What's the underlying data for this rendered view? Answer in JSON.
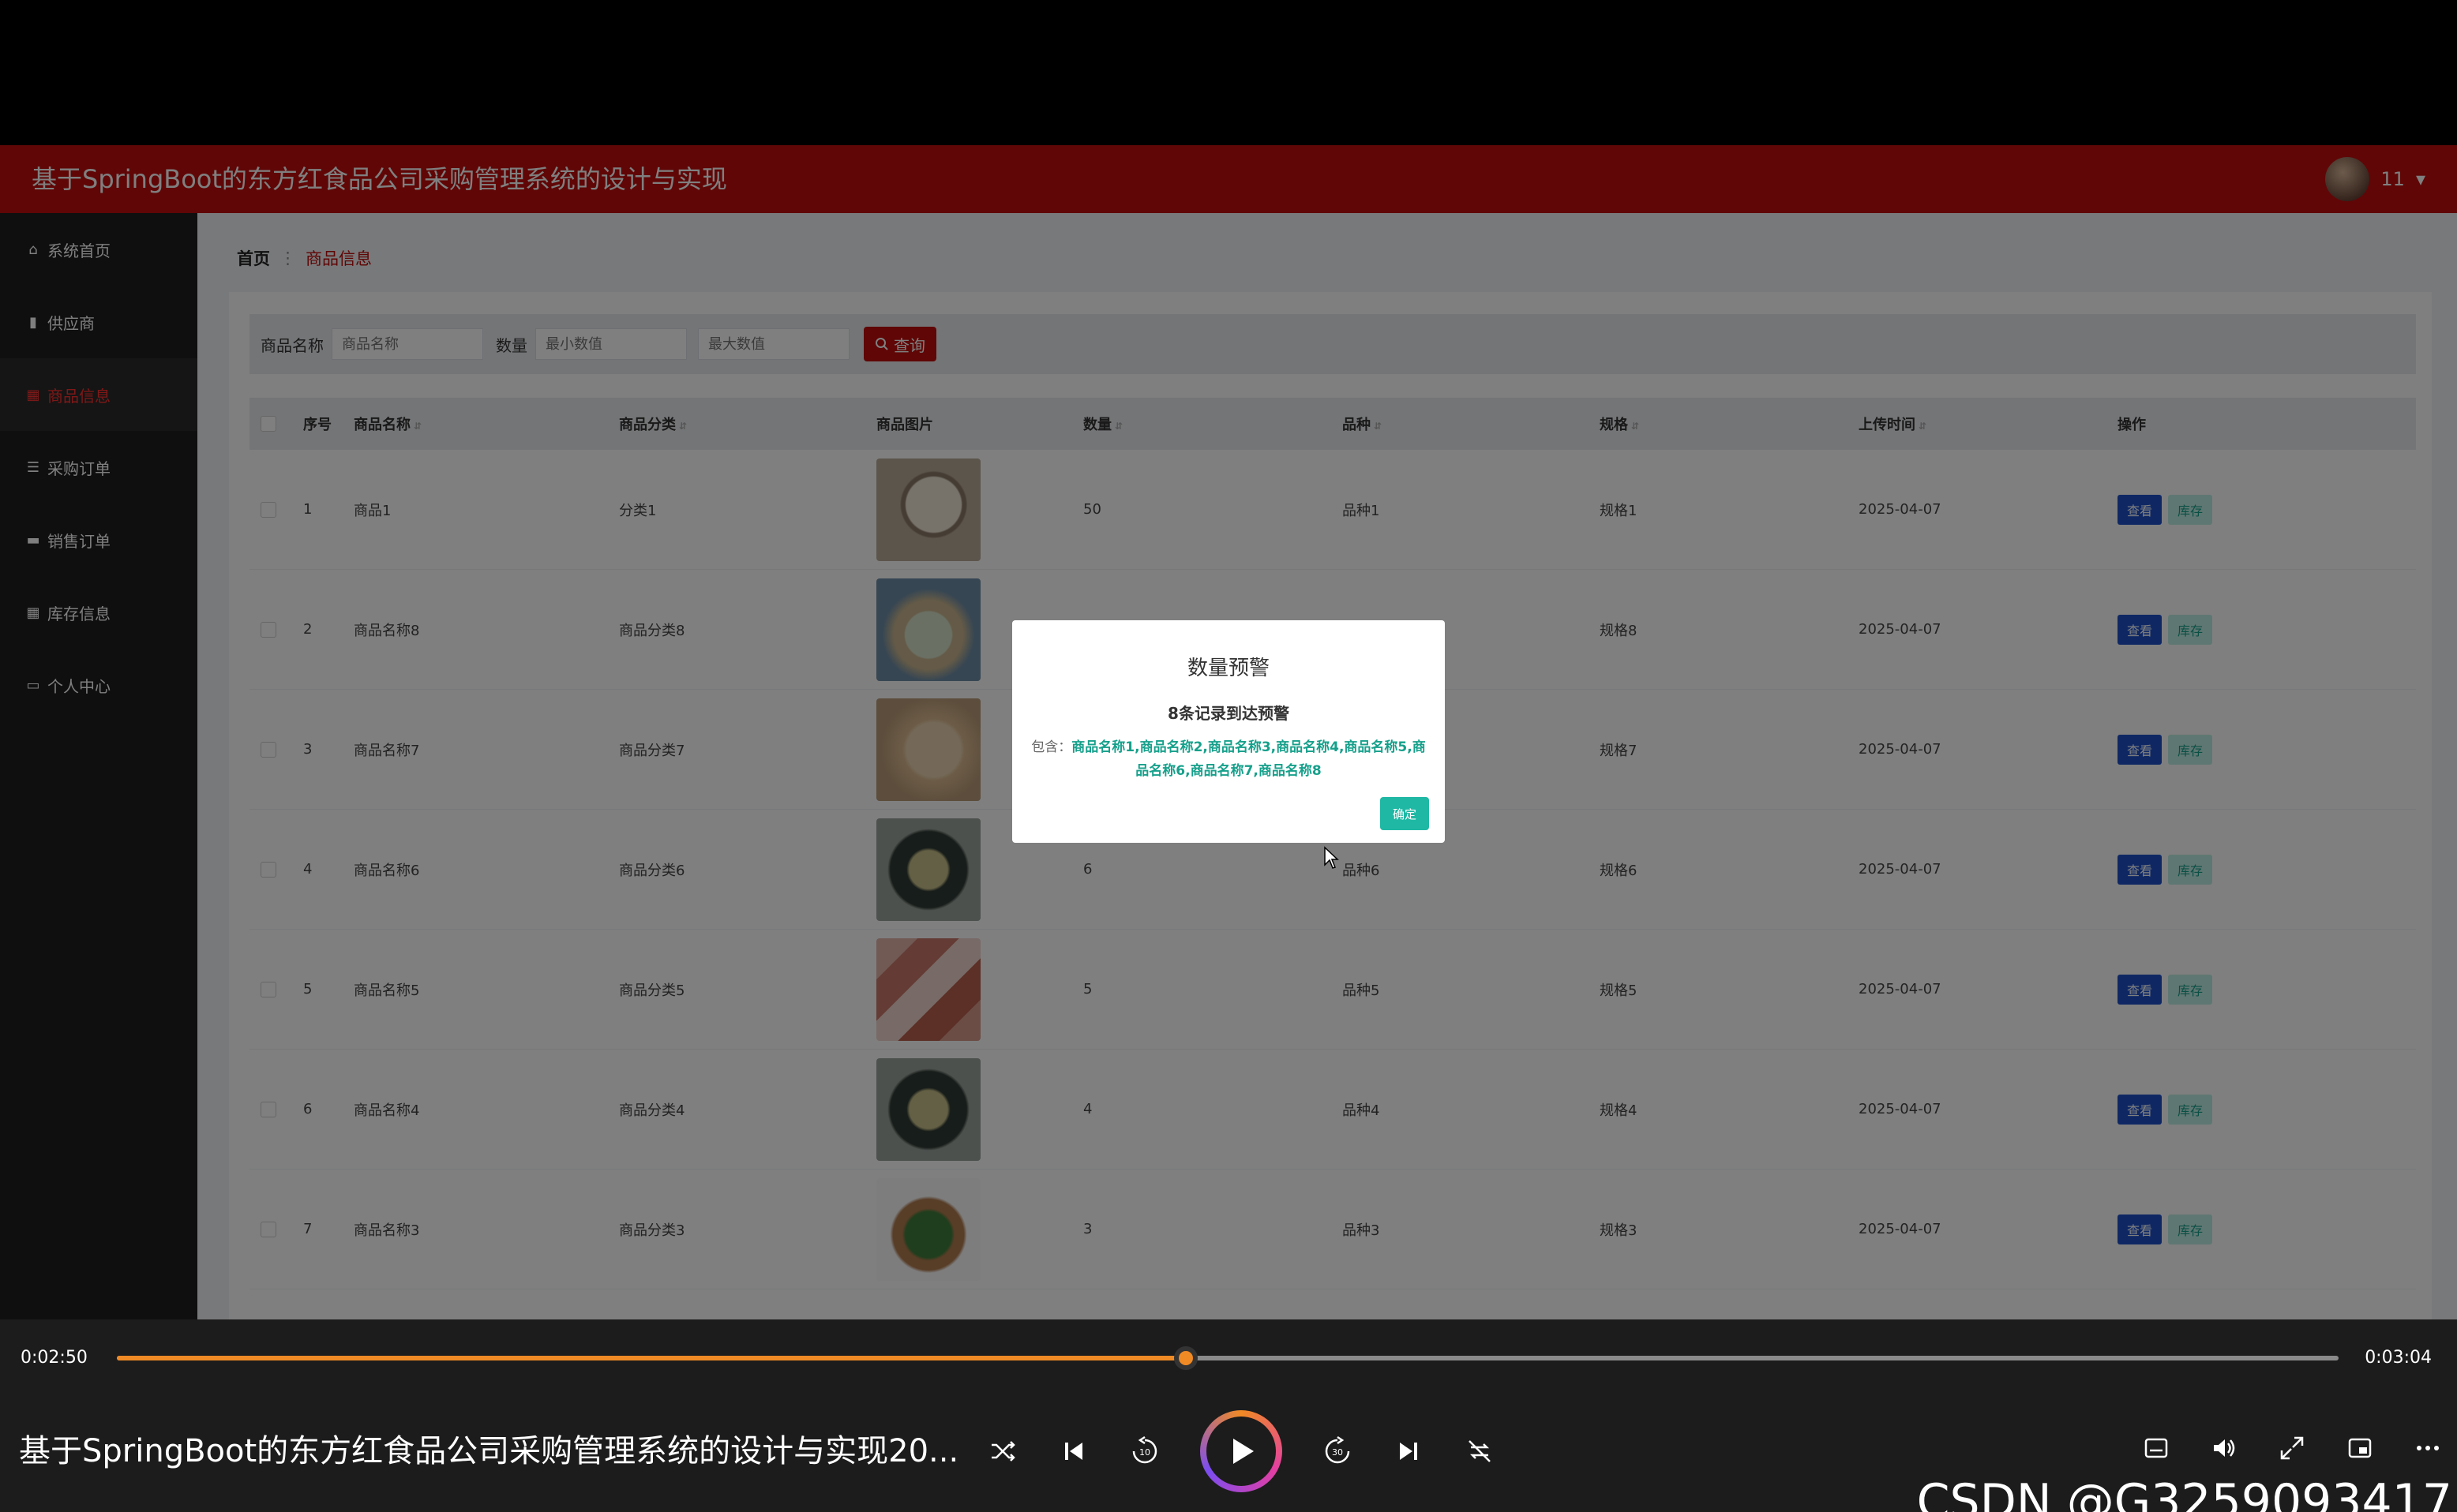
{
  "app": {
    "title": "基于SpringBoot的东方红食品公司采购管理系统的设计与实现",
    "user": "11"
  },
  "sidebar": {
    "items": [
      {
        "label": "系统首页",
        "icon": "home-icon"
      },
      {
        "label": "供应商",
        "icon": "chart-icon"
      },
      {
        "label": "商品信息",
        "icon": "grid-icon",
        "active": true
      },
      {
        "label": "采购订单",
        "icon": "sliders-icon"
      },
      {
        "label": "销售订单",
        "icon": "chat-icon"
      },
      {
        "label": "库存信息",
        "icon": "grid-icon"
      },
      {
        "label": "个人中心",
        "icon": "profile-icon"
      }
    ]
  },
  "breadcrumb": {
    "home": "首页",
    "current": "商品信息"
  },
  "search": {
    "name_label": "商品名称",
    "name_placeholder": "商品名称",
    "qty_label": "数量",
    "min_placeholder": "最小数值",
    "max_placeholder": "最大数值",
    "button": "查询"
  },
  "table": {
    "headers": [
      "序号",
      "商品名称",
      "商品分类",
      "商品图片",
      "数量",
      "品种",
      "规格",
      "上传时间",
      "操作"
    ],
    "rows": [
      {
        "idx": "1",
        "name": "商品1",
        "cat": "分类1",
        "qty": "50",
        "variety": "品种1",
        "spec": "规格1",
        "date": "2025-04-07"
      },
      {
        "idx": "2",
        "name": "商品名称8",
        "cat": "商品分类8",
        "qty": "",
        "variety": "",
        "spec": "规格8",
        "date": "2025-04-07"
      },
      {
        "idx": "3",
        "name": "商品名称7",
        "cat": "商品分类7",
        "qty": "",
        "variety": "",
        "spec": "规格7",
        "date": "2025-04-07"
      },
      {
        "idx": "4",
        "name": "商品名称6",
        "cat": "商品分类6",
        "qty": "6",
        "variety": "品种6",
        "spec": "规格6",
        "date": "2025-04-07"
      },
      {
        "idx": "5",
        "name": "商品名称5",
        "cat": "商品分类5",
        "qty": "5",
        "variety": "品种5",
        "spec": "规格5",
        "date": "2025-04-07"
      },
      {
        "idx": "6",
        "name": "商品名称4",
        "cat": "商品分类4",
        "qty": "4",
        "variety": "品种4",
        "spec": "规格4",
        "date": "2025-04-07"
      },
      {
        "idx": "7",
        "name": "商品名称3",
        "cat": "商品分类3",
        "qty": "3",
        "variety": "品种3",
        "spec": "规格3",
        "date": "2025-04-07"
      }
    ],
    "view_label": "查看",
    "stock_label": "库存"
  },
  "modal": {
    "title": "数量预警",
    "subtitle": "8条记录到达预警",
    "detail_prefix": "包含：",
    "items": "商品名称1,商品名称2,商品名称3,商品名称4,商品名称5,商品名称6,商品名称7,商品名称8",
    "ok": "确定"
  },
  "player": {
    "time_current": "0:02:50",
    "time_total": "0:03:04",
    "progress": 0.481,
    "title": "基于SpringBoot的东方红食品公司采购管理系统的设计与实现20...",
    "watermark": "CSDN @G3259093417",
    "accent": "#f08a24"
  },
  "colors": {
    "brand_red": "#c00d0d",
    "view_blue": "#1e50c8",
    "teal": "#1fb8a4"
  }
}
